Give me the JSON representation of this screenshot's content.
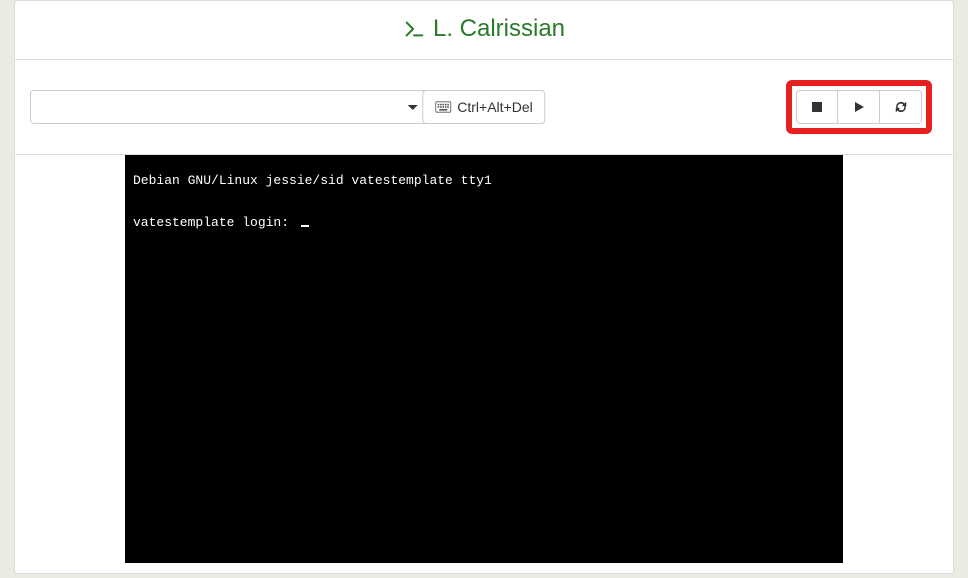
{
  "header": {
    "title": "L. Calrissian"
  },
  "toolbar": {
    "iso_selected": "",
    "cad_label": "Ctrl+Alt+Del"
  },
  "console": {
    "line1": "Debian GNU/Linux jessie/sid vatestemplate tty1",
    "line2": "vatestemplate login: "
  }
}
